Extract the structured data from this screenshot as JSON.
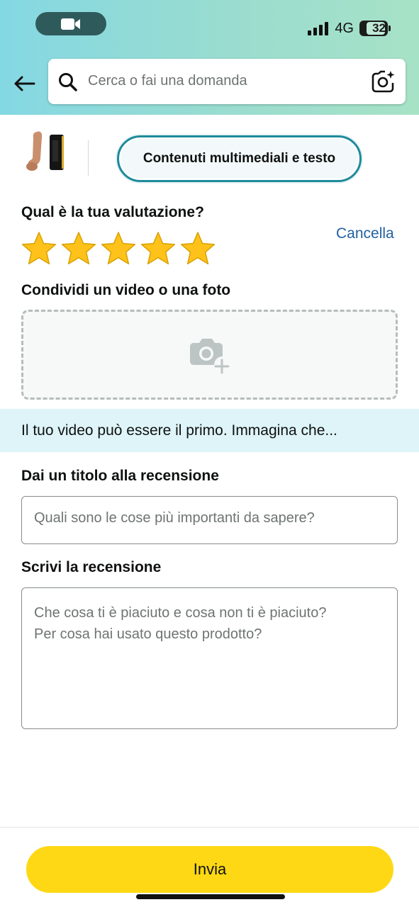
{
  "status_bar": {
    "network": "4G",
    "battery": "32"
  },
  "search": {
    "placeholder": "Cerca o fai una domanda"
  },
  "media_tab": {
    "label": "Contenuti multimediali e testo"
  },
  "rating": {
    "question": "Qual è la tua valutazione?",
    "cancel_label": "Cancella",
    "value": 5,
    "max": 5,
    "star_color": "#ffc21a"
  },
  "media_upload": {
    "label": "Condividi un video o una foto"
  },
  "info_banner": {
    "text": "Il tuo video può essere il primo. Immagina che..."
  },
  "review_title": {
    "label": "Dai un titolo alla recensione",
    "placeholder": "Quali sono le cose più importanti da sapere?"
  },
  "review_body": {
    "label": "Scrivi la recensione",
    "placeholder": "Che cosa ti è piaciuto e cosa non ti è piaciuto?\nPer cosa hai usato questo prodotto?"
  },
  "submit": {
    "label": "Invia",
    "color": "#fed814"
  }
}
